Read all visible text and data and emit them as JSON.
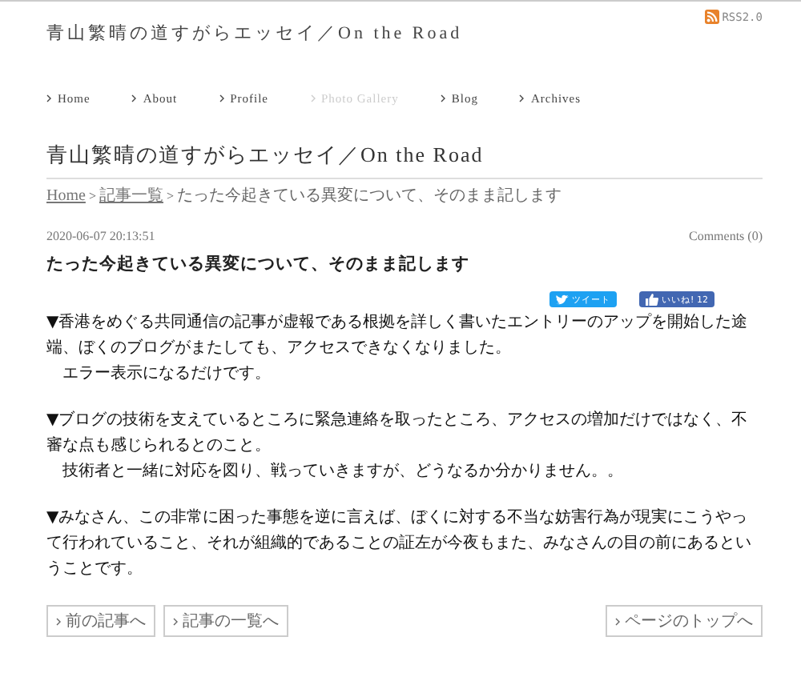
{
  "site_title": "青山繁晴の道すがらエッセイ／On the Road",
  "rss": "RSS2.0",
  "nav": [
    {
      "label": "Home",
      "disabled": false
    },
    {
      "label": "About",
      "disabled": false
    },
    {
      "label": "Profile",
      "disabled": false
    },
    {
      "label": "Photo Gallery",
      "disabled": true
    },
    {
      "label": "Blog",
      "disabled": false
    },
    {
      "label": "Archives",
      "disabled": false
    }
  ],
  "page_title": "青山繁晴の道すがらエッセイ／On the Road",
  "breadcrumb": [
    {
      "label": "Home",
      "link": true
    },
    {
      "label": "記事一覧",
      "link": true
    },
    {
      "label": "たった今起きている異変について、そのまま記します",
      "link": false
    }
  ],
  "breadcrumb_separator": ">",
  "post": {
    "date": "2020-06-07 20:13:51",
    "comments": "Comments (0)",
    "title": "たった今起きている異変について、そのまま記します",
    "tweet": "ツイート",
    "like": "いいね! 12",
    "paragraphs": [
      {
        "lines": [
          "▼香港をめぐる共同通信の記事が虚報である根拠を詳しく書いたエントリーのアップを開始した途端、ぼくのブログがまたしても、アクセスできなくなりました。",
          "　エラー表示になるだけです。"
        ]
      },
      {
        "lines": [
          "▼ブログの技術を支えているところに緊急連絡を取ったところ、アクセスの増加だけではなく、不審な点も感じられるとのこと。",
          "　技術者と一緒に対応を図り、戦っていきますが、どうなるか分かりません。。"
        ]
      },
      {
        "lines": [
          "▼みなさん、この非常に困った事態を逆に言えば、ぼくに対する不当な妨害行為が現実にこうやって行われていること、それが組織的であることの証左が今夜もまた、みなさんの目の前にあるということです。"
        ]
      }
    ]
  },
  "footer_links": {
    "left": [
      "前の記事へ",
      "記事の一覧へ"
    ],
    "right": "ページのトップへ"
  }
}
